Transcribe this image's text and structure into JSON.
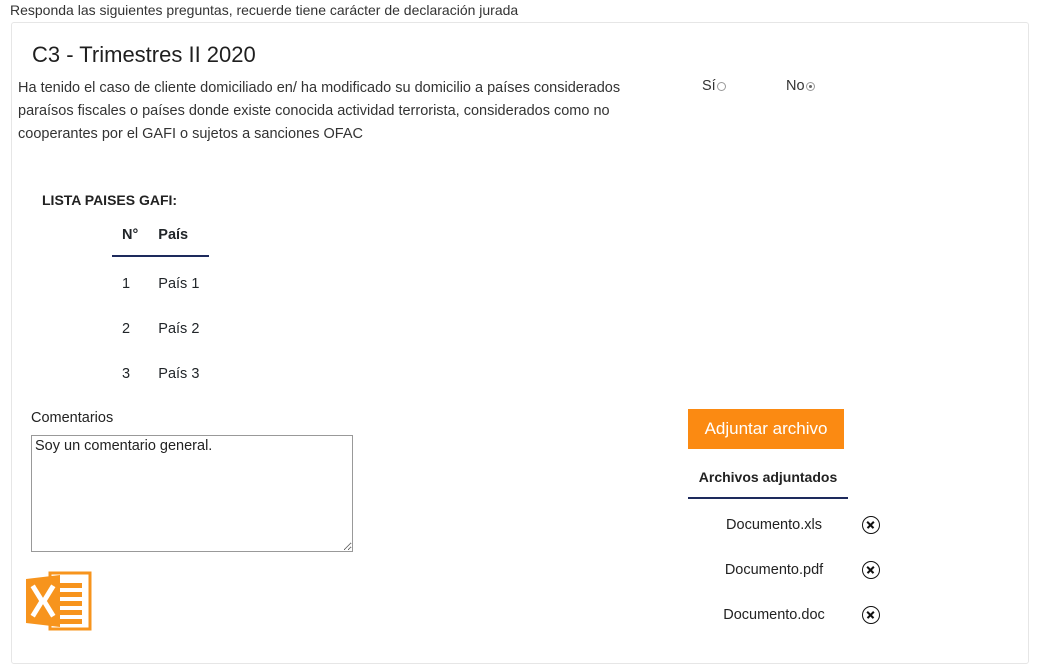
{
  "intro": "Responda las siguientes preguntas, recuerde tiene carácter de declaración jurada",
  "title": "C3 - Trimestres II 2020",
  "question": "Ha tenido el caso de cliente domiciliado en/ ha modificado su domicilio a países considerados paraísos fiscales o países donde existe conocida actividad terrorista, considerados como no cooperantes por el GAFI o sujetos a sanciones OFAC",
  "options": {
    "si": "Sí",
    "no": "No",
    "selected": "no"
  },
  "lista": {
    "title": "LISTA PAISES GAFI:",
    "headers": {
      "num": "N°",
      "pais": "País"
    },
    "rows": [
      {
        "num": "1",
        "pais": "País 1"
      },
      {
        "num": "2",
        "pais": "País 2"
      },
      {
        "num": "3",
        "pais": "País 3"
      }
    ]
  },
  "comentarios": {
    "label": "Comentarios",
    "value": "Soy un comentario general."
  },
  "attach": {
    "button": "Adjuntar archivo",
    "header": "Archivos adjuntados"
  },
  "files": [
    "Documento.xls",
    "Documento.pdf",
    "Documento.doc"
  ],
  "colors": {
    "accent": "#fb8a12",
    "excel": "#f7941d",
    "underline": "#1d2a5c"
  },
  "icons": {
    "excel": "excel-file-icon",
    "remove": "close-circle-icon"
  }
}
